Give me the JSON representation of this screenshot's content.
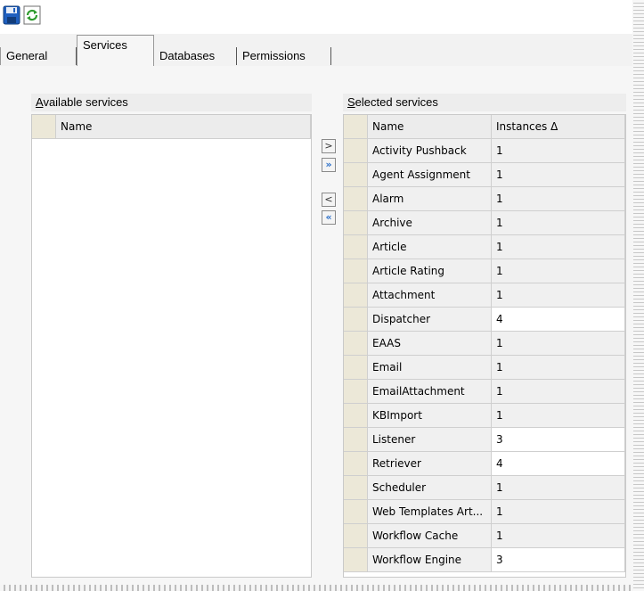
{
  "toolbar": {
    "save_icon": "save-disk-icon",
    "refresh_icon": "refresh-icon"
  },
  "tabs": [
    {
      "label": "General",
      "active": false
    },
    {
      "label": "Services",
      "active": true
    },
    {
      "label": "Databases",
      "active": false
    },
    {
      "label": "Permissions",
      "active": false
    }
  ],
  "available": {
    "title_hotkey": "A",
    "title_rest": "vailable services",
    "column_name": "Name",
    "rows": []
  },
  "transfer": {
    "add": ">",
    "add_all": "»",
    "remove": "<",
    "remove_all": "«"
  },
  "selected": {
    "title_hotkey": "S",
    "title_rest": "elected services",
    "column_name": "Name",
    "column_instances": "Instances Δ",
    "rows": [
      {
        "name": "Activity Pushback",
        "instances": "1"
      },
      {
        "name": "Agent Assignment",
        "instances": "1"
      },
      {
        "name": "Alarm",
        "instances": "1"
      },
      {
        "name": "Archive",
        "instances": "1"
      },
      {
        "name": "Article",
        "instances": "1"
      },
      {
        "name": "Article Rating",
        "instances": "1"
      },
      {
        "name": "Attachment",
        "instances": "1"
      },
      {
        "name": "Dispatcher",
        "instances": "4"
      },
      {
        "name": "EAAS",
        "instances": "1"
      },
      {
        "name": "Email",
        "instances": "1"
      },
      {
        "name": "EmailAttachment",
        "instances": "1"
      },
      {
        "name": "KBImport",
        "instances": "1"
      },
      {
        "name": "Listener",
        "instances": "3"
      },
      {
        "name": "Retriever",
        "instances": "4"
      },
      {
        "name": "Scheduler",
        "instances": "1"
      },
      {
        "name": "Web Templates Art...",
        "instances": "1"
      },
      {
        "name": "Workflow Cache",
        "instances": "1"
      },
      {
        "name": "Workflow Engine",
        "instances": "3"
      }
    ]
  }
}
